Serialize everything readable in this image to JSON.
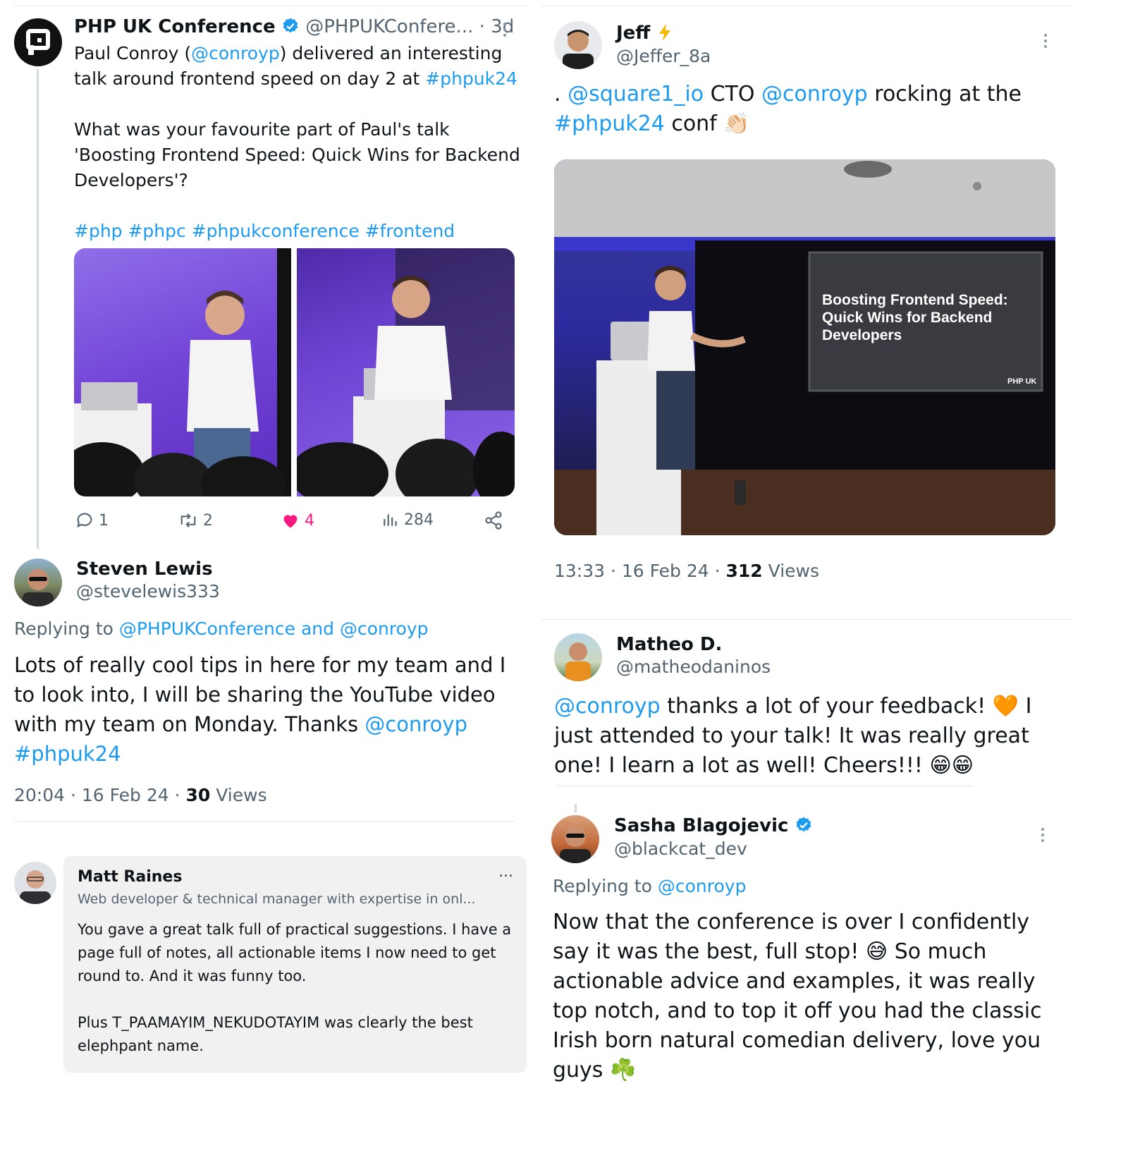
{
  "tweet1": {
    "name": "PHP UK Conference",
    "handle": "@PHPUKConfere...",
    "time": "· 3d",
    "line1_pre": "Paul Conroy (",
    "line1_mention": "@conroyp",
    "line1_post": ") delivered an interesting",
    "line2_pre": "talk around frontend speed on day 2 at ",
    "line2_tag": "#phpuk24",
    "q1": "What was your favourite part of Paul's talk",
    "q2": "'Boosting Frontend Speed: Quick Wins for Backend",
    "q3": "Developers'?",
    "hashtags": "#php #phpc #phpukconference #frontend",
    "replies": "1",
    "reposts": "2",
    "likes": "4",
    "views": "284"
  },
  "reply_steven": {
    "name": "Steven Lewis",
    "handle": "@stevelewis333",
    "replying_label": "Replying to ",
    "replying_to": "@PHPUKConference and @conroyp",
    "line1": "Lots of really cool tips in here for my team and I",
    "line2": "to look into, I will be sharing the YouTube video",
    "line3_pre": "with my team on Monday. Thanks ",
    "line3_mention": "@conroyp",
    "line4_tag": "#phpuk24",
    "time": "20:04 · 16 Feb 24 · ",
    "views_count": "30",
    "views_label": " Views"
  },
  "comment_matt": {
    "name": "Matt Raines",
    "headline": "Web developer & technical manager with expertise in onl...",
    "p1_l1": "You gave a great talk full of practical suggestions. I have a",
    "p1_l2": "page full of notes, all actionable items I now need to get",
    "p1_l3": "round to. And it was funny too.",
    "p2_l1": "Plus T_PAAMAYIM_NEKUDOTAYIM was clearly the best",
    "p2_l2": "elephpant name.",
    "more": "..."
  },
  "tweet_jeff": {
    "name": "Jeff",
    "handle": "@Jeffer_8a",
    "l1_pre": ". ",
    "l1_m1": "@square1_io",
    "l1_mid": " CTO ",
    "l1_m2": "@conroyp",
    "l1_post": " rocking at the",
    "l2_tag": "#phpuk24",
    "l2_post": " conf",
    "slide_l1": "Boosting Frontend Speed:",
    "slide_l2": "Quick Wins for Backend",
    "slide_l3": "Developers",
    "slide_logo": "PHP UK",
    "time": "13:33 · 16 Feb 24 · ",
    "views_count": "312",
    "views_label": " Views"
  },
  "tweet_matheo": {
    "name": "Matheo D.",
    "handle": "@matheodaninos",
    "l1_mention": "@conroyp",
    "l1_post": " thanks a lot of your feedback! ",
    "l1_end": " I",
    "l2": "just attended to your talk! It was really great",
    "l3": "one! I learn a lot as well! Cheers!!! "
  },
  "tweet_sasha": {
    "name": "Sasha Blagojevic",
    "handle": "@blackcat_dev",
    "replying_label": "Replying to ",
    "replying_to": "@conroyp",
    "l1": "Now that the conference is over I confidently",
    "l2_pre": "say it was the best, full stop! ",
    "l2_post": " So much",
    "l3": "actionable advice and examples, it was really",
    "l4": "top notch, and to top it off you had the classic",
    "l5": "Irish born natural comedian delivery, love you",
    "l6": "guys "
  },
  "colors": {
    "link": "#1d9bf0",
    "muted": "#536471",
    "like": "#f91880",
    "verified": "#1d9bf0"
  }
}
